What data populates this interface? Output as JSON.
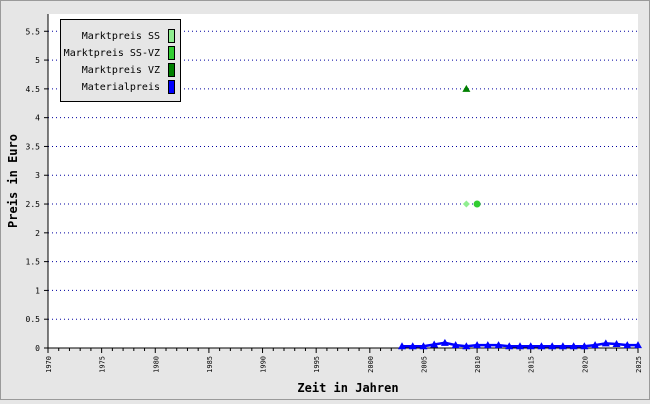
{
  "chart_data": {
    "type": "scatter",
    "xlabel": "Zeit in Jahren",
    "ylabel": "Preis in Euro",
    "xlim": [
      1970,
      2025
    ],
    "ylim": [
      0,
      5.8
    ],
    "xticks": [
      "1970",
      "1975",
      "1980",
      "1985",
      "1990",
      "1995",
      "2000",
      "2005",
      "2010",
      "2015",
      "2020",
      "2025"
    ],
    "yticks": [
      "0",
      "0.5",
      "1",
      "1.5",
      "2",
      "2.5",
      "3",
      "3.5",
      "4",
      "4.5",
      "5",
      "5.5"
    ],
    "grid": "horizontal-dotted",
    "legend_position": "top-left",
    "series": [
      {
        "name": "Marktpreis SS",
        "color": "#90ee90",
        "marker": "diamond",
        "points": [
          {
            "x": 2009,
            "y": 2.5
          }
        ]
      },
      {
        "name": "Marktpreis SS-VZ",
        "color": "#32cd32",
        "marker": "circle",
        "points": [
          {
            "x": 2010,
            "y": 2.5
          }
        ]
      },
      {
        "name": "Marktpreis VZ",
        "color": "#008000",
        "marker": "triangle",
        "points": [
          {
            "x": 2009,
            "y": 4.5
          }
        ]
      },
      {
        "name": "Materialpreis",
        "color": "#0000ff",
        "marker": "triangle-line",
        "points": [
          {
            "x": 2003,
            "y": 0.03
          },
          {
            "x": 2004,
            "y": 0.03
          },
          {
            "x": 2005,
            "y": 0.03
          },
          {
            "x": 2006,
            "y": 0.06
          },
          {
            "x": 2007,
            "y": 0.09
          },
          {
            "x": 2008,
            "y": 0.05
          },
          {
            "x": 2009,
            "y": 0.03
          },
          {
            "x": 2010,
            "y": 0.05
          },
          {
            "x": 2011,
            "y": 0.05
          },
          {
            "x": 2012,
            "y": 0.05
          },
          {
            "x": 2013,
            "y": 0.03
          },
          {
            "x": 2014,
            "y": 0.03
          },
          {
            "x": 2015,
            "y": 0.03
          },
          {
            "x": 2016,
            "y": 0.03
          },
          {
            "x": 2017,
            "y": 0.03
          },
          {
            "x": 2018,
            "y": 0.03
          },
          {
            "x": 2019,
            "y": 0.03
          },
          {
            "x": 2020,
            "y": 0.03
          },
          {
            "x": 2021,
            "y": 0.05
          },
          {
            "x": 2022,
            "y": 0.08
          },
          {
            "x": 2023,
            "y": 0.07
          },
          {
            "x": 2024,
            "y": 0.05
          },
          {
            "x": 2025,
            "y": 0.05
          }
        ]
      }
    ]
  }
}
